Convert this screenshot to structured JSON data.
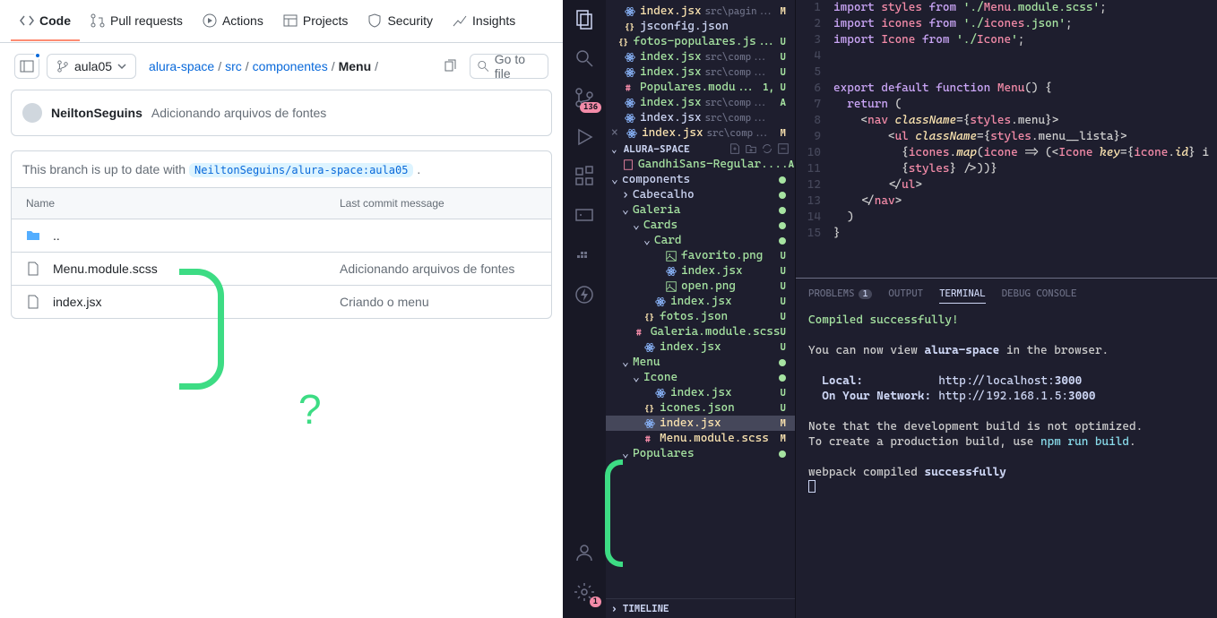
{
  "github": {
    "tabs": {
      "code": "Code",
      "pulls": "Pull requests",
      "actions": "Actions",
      "projects": "Projects",
      "security": "Security",
      "insights": "Insights"
    },
    "branch": "aula05",
    "breadcrumb": [
      "alura-space",
      "src",
      "componentes",
      "Menu"
    ],
    "search_placeholder": "Go to file",
    "commit": {
      "author": "NeiltonSeguins",
      "message": "Adicionando arquivos de fontes"
    },
    "branch_status_prefix": "This branch is up to date with",
    "branch_status_ref": "NeiltonSeguins/alura-space:aula05",
    "table": {
      "col_name": "Name",
      "col_msg": "Last commit message",
      "rows": [
        {
          "name": "..",
          "type": "dir",
          "msg": ""
        },
        {
          "name": "Menu.module.scss",
          "type": "file",
          "msg": "Adicionando arquivos de fontes"
        },
        {
          "name": "index.jsx",
          "type": "file",
          "msg": "Criando o menu"
        }
      ]
    },
    "annotation_q": "?"
  },
  "vscode": {
    "scm_badge": "136",
    "open_editors": [
      {
        "name": "index.jsx",
        "path": "src\\pagin...",
        "status": "M",
        "icon": "react",
        "color": "mod"
      },
      {
        "name": "jsconfig.json",
        "path": "",
        "status": "",
        "icon": "json",
        "color": ""
      },
      {
        "name": "fotos-populares.js...",
        "path": "",
        "status": "U",
        "icon": "json",
        "color": "green"
      },
      {
        "name": "index.jsx",
        "path": "src\\comp...",
        "status": "U",
        "icon": "react",
        "color": "green"
      },
      {
        "name": "index.jsx",
        "path": "src\\comp...",
        "status": "U",
        "icon": "react",
        "color": "green"
      },
      {
        "name": "Populares.modu...",
        "path": "",
        "status": "1, U",
        "icon": "scss",
        "color": "green"
      },
      {
        "name": "index.jsx",
        "path": "src\\comp...",
        "status": "A",
        "icon": "react",
        "color": "green"
      },
      {
        "name": "index.jsx",
        "path": "src\\comp...",
        "status": "",
        "icon": "react",
        "color": ""
      },
      {
        "name": "index.jsx",
        "path": "src\\comp...",
        "status": "M",
        "icon": "react",
        "color": "mod",
        "close": true
      }
    ],
    "project_name": "ALURA-SPACE",
    "tree": [
      {
        "name": "GandhiSans-Regular....",
        "indent": 1,
        "status": "A",
        "color": "green",
        "icon": "font"
      },
      {
        "name": "components",
        "indent": 0,
        "chev": "open",
        "dot": true
      },
      {
        "name": "Cabecalho",
        "indent": 1,
        "chev": "closed",
        "dot": true
      },
      {
        "name": "Galeria",
        "indent": 1,
        "chev": "open",
        "dot": true,
        "color": "green"
      },
      {
        "name": "Cards",
        "indent": 2,
        "chev": "open",
        "dot": true,
        "color": "green"
      },
      {
        "name": "Card",
        "indent": 3,
        "chev": "open",
        "dot": true,
        "color": "green"
      },
      {
        "name": "favorito.png",
        "indent": 4,
        "status": "U",
        "icon": "img",
        "color": "green"
      },
      {
        "name": "index.jsx",
        "indent": 4,
        "status": "U",
        "icon": "react",
        "color": "green"
      },
      {
        "name": "open.png",
        "indent": 4,
        "status": "U",
        "icon": "img",
        "color": "green"
      },
      {
        "name": "index.jsx",
        "indent": 3,
        "status": "U",
        "icon": "react",
        "color": "green"
      },
      {
        "name": "fotos.json",
        "indent": 2,
        "status": "U",
        "icon": "json",
        "color": "green"
      },
      {
        "name": "Galeria.module.scss",
        "indent": 2,
        "status": "U",
        "icon": "scss",
        "color": "green"
      },
      {
        "name": "index.jsx",
        "indent": 2,
        "status": "U",
        "icon": "react",
        "color": "green"
      },
      {
        "name": "Menu",
        "indent": 1,
        "chev": "open",
        "dot": true,
        "color": "green"
      },
      {
        "name": "Icone",
        "indent": 2,
        "chev": "open",
        "dot": true,
        "color": "green"
      },
      {
        "name": "index.jsx",
        "indent": 3,
        "status": "U",
        "icon": "react",
        "color": "green"
      },
      {
        "name": "icones.json",
        "indent": 2,
        "status": "U",
        "icon": "json",
        "color": "green"
      },
      {
        "name": "index.jsx",
        "indent": 2,
        "status": "M",
        "icon": "react",
        "color": "mod",
        "selected": true
      },
      {
        "name": "Menu.module.scss",
        "indent": 2,
        "status": "M",
        "icon": "scss",
        "color": "mod"
      },
      {
        "name": "Populares",
        "indent": 1,
        "chev": "open",
        "dot": true,
        "color": "green"
      }
    ],
    "timeline": "TIMELINE",
    "editor": {
      "start_line": 1,
      "lines": [
        "import styles from './Menu.module.scss';",
        "import icones from './icones.json';",
        "import Icone from './Icone';",
        "",
        "",
        "export default function Menu() {",
        "  return (",
        "    <nav className={styles.menu}>",
        "        <ul className={styles.menu__lista}>",
        "          {icones.map(icone => (<Icone key={icone.id} i",
        "          {styles} />))}",
        "        </ul>",
        "    </nav>",
        "  )",
        "}"
      ]
    },
    "panel": {
      "tabs": {
        "problems": "PROBLEMS",
        "problems_badge": "1",
        "output": "OUTPUT",
        "terminal": "TERMINAL",
        "debug": "DEBUG CONSOLE"
      },
      "terminal": {
        "l1": "Compiled successfully!",
        "l2a": "You can now view ",
        "l2b": "alura-space",
        "l2c": " in the browser.",
        "l3a": "Local:",
        "l3b": "http://localhost:",
        "l3c": "3000",
        "l4a": "On Your Network:",
        "l4b": "http://192.168.1.5:",
        "l4c": "3000",
        "l5": "Note that the development build is not optimized.",
        "l6a": "To create a production build, use ",
        "l6b": "npm run build",
        "l6c": ".",
        "l7a": "webpack compiled ",
        "l7b": "successfully"
      }
    }
  }
}
